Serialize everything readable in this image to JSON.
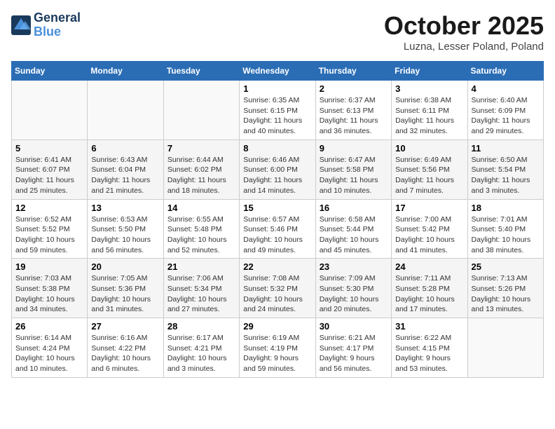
{
  "header": {
    "logo_line1": "General",
    "logo_line2": "Blue",
    "month": "October 2025",
    "location": "Luzna, Lesser Poland, Poland"
  },
  "weekdays": [
    "Sunday",
    "Monday",
    "Tuesday",
    "Wednesday",
    "Thursday",
    "Friday",
    "Saturday"
  ],
  "weeks": [
    [
      {
        "day": "",
        "info": ""
      },
      {
        "day": "",
        "info": ""
      },
      {
        "day": "",
        "info": ""
      },
      {
        "day": "1",
        "info": "Sunrise: 6:35 AM\nSunset: 6:15 PM\nDaylight: 11 hours\nand 40 minutes."
      },
      {
        "day": "2",
        "info": "Sunrise: 6:37 AM\nSunset: 6:13 PM\nDaylight: 11 hours\nand 36 minutes."
      },
      {
        "day": "3",
        "info": "Sunrise: 6:38 AM\nSunset: 6:11 PM\nDaylight: 11 hours\nand 32 minutes."
      },
      {
        "day": "4",
        "info": "Sunrise: 6:40 AM\nSunset: 6:09 PM\nDaylight: 11 hours\nand 29 minutes."
      }
    ],
    [
      {
        "day": "5",
        "info": "Sunrise: 6:41 AM\nSunset: 6:07 PM\nDaylight: 11 hours\nand 25 minutes."
      },
      {
        "day": "6",
        "info": "Sunrise: 6:43 AM\nSunset: 6:04 PM\nDaylight: 11 hours\nand 21 minutes."
      },
      {
        "day": "7",
        "info": "Sunrise: 6:44 AM\nSunset: 6:02 PM\nDaylight: 11 hours\nand 18 minutes."
      },
      {
        "day": "8",
        "info": "Sunrise: 6:46 AM\nSunset: 6:00 PM\nDaylight: 11 hours\nand 14 minutes."
      },
      {
        "day": "9",
        "info": "Sunrise: 6:47 AM\nSunset: 5:58 PM\nDaylight: 11 hours\nand 10 minutes."
      },
      {
        "day": "10",
        "info": "Sunrise: 6:49 AM\nSunset: 5:56 PM\nDaylight: 11 hours\nand 7 minutes."
      },
      {
        "day": "11",
        "info": "Sunrise: 6:50 AM\nSunset: 5:54 PM\nDaylight: 11 hours\nand 3 minutes."
      }
    ],
    [
      {
        "day": "12",
        "info": "Sunrise: 6:52 AM\nSunset: 5:52 PM\nDaylight: 10 hours\nand 59 minutes."
      },
      {
        "day": "13",
        "info": "Sunrise: 6:53 AM\nSunset: 5:50 PM\nDaylight: 10 hours\nand 56 minutes."
      },
      {
        "day": "14",
        "info": "Sunrise: 6:55 AM\nSunset: 5:48 PM\nDaylight: 10 hours\nand 52 minutes."
      },
      {
        "day": "15",
        "info": "Sunrise: 6:57 AM\nSunset: 5:46 PM\nDaylight: 10 hours\nand 49 minutes."
      },
      {
        "day": "16",
        "info": "Sunrise: 6:58 AM\nSunset: 5:44 PM\nDaylight: 10 hours\nand 45 minutes."
      },
      {
        "day": "17",
        "info": "Sunrise: 7:00 AM\nSunset: 5:42 PM\nDaylight: 10 hours\nand 41 minutes."
      },
      {
        "day": "18",
        "info": "Sunrise: 7:01 AM\nSunset: 5:40 PM\nDaylight: 10 hours\nand 38 minutes."
      }
    ],
    [
      {
        "day": "19",
        "info": "Sunrise: 7:03 AM\nSunset: 5:38 PM\nDaylight: 10 hours\nand 34 minutes."
      },
      {
        "day": "20",
        "info": "Sunrise: 7:05 AM\nSunset: 5:36 PM\nDaylight: 10 hours\nand 31 minutes."
      },
      {
        "day": "21",
        "info": "Sunrise: 7:06 AM\nSunset: 5:34 PM\nDaylight: 10 hours\nand 27 minutes."
      },
      {
        "day": "22",
        "info": "Sunrise: 7:08 AM\nSunset: 5:32 PM\nDaylight: 10 hours\nand 24 minutes."
      },
      {
        "day": "23",
        "info": "Sunrise: 7:09 AM\nSunset: 5:30 PM\nDaylight: 10 hours\nand 20 minutes."
      },
      {
        "day": "24",
        "info": "Sunrise: 7:11 AM\nSunset: 5:28 PM\nDaylight: 10 hours\nand 17 minutes."
      },
      {
        "day": "25",
        "info": "Sunrise: 7:13 AM\nSunset: 5:26 PM\nDaylight: 10 hours\nand 13 minutes."
      }
    ],
    [
      {
        "day": "26",
        "info": "Sunrise: 6:14 AM\nSunset: 4:24 PM\nDaylight: 10 hours\nand 10 minutes."
      },
      {
        "day": "27",
        "info": "Sunrise: 6:16 AM\nSunset: 4:22 PM\nDaylight: 10 hours\nand 6 minutes."
      },
      {
        "day": "28",
        "info": "Sunrise: 6:17 AM\nSunset: 4:21 PM\nDaylight: 10 hours\nand 3 minutes."
      },
      {
        "day": "29",
        "info": "Sunrise: 6:19 AM\nSunset: 4:19 PM\nDaylight: 9 hours\nand 59 minutes."
      },
      {
        "day": "30",
        "info": "Sunrise: 6:21 AM\nSunset: 4:17 PM\nDaylight: 9 hours\nand 56 minutes."
      },
      {
        "day": "31",
        "info": "Sunrise: 6:22 AM\nSunset: 4:15 PM\nDaylight: 9 hours\nand 53 minutes."
      },
      {
        "day": "",
        "info": ""
      }
    ]
  ]
}
